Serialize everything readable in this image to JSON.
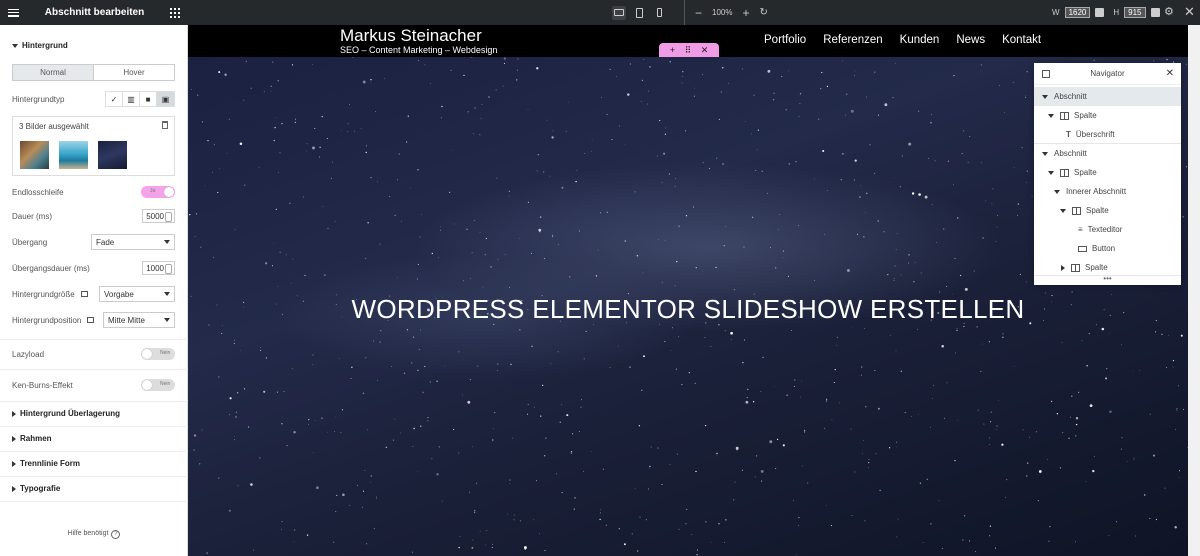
{
  "topbar": {
    "panel_title": "Abschnitt bearbeiten",
    "zoom_level": "100%",
    "width_label": "W",
    "width_value": "1620",
    "height_label": "H",
    "height_value": "915"
  },
  "sidebar": {
    "section_title": "Hintergrund",
    "tab_normal": "Normal",
    "tab_hover": "Hover",
    "bg_type_label": "Hintergrundtyp",
    "gallery_label": "3 Bilder ausgewählt",
    "loop_label": "Endlosschleife",
    "loop_toggle_text": "Ja",
    "duration_label": "Dauer (ms)",
    "duration_value": "5000",
    "transition_label": "Übergang",
    "transition_value": "Fade",
    "transition_duration_label": "Übergangsdauer (ms)",
    "transition_duration_value": "1000",
    "bg_size_label": "Hintergrundgröße",
    "bg_size_value": "Vorgabe",
    "bg_position_label": "Hintergrundposition",
    "bg_position_value": "Mitte Mitte",
    "lazyload_label": "Lazyload",
    "lazyload_toggle_text": "Nein",
    "kenburns_label": "Ken-Burns-Effekt",
    "kenburns_toggle_text": "Nein",
    "collapsed_sections": [
      "Hintergrund Überlagerung",
      "Rahmen",
      "Trennlinie Form",
      "Typografie"
    ],
    "help_text": "Hilfe benötigt"
  },
  "site": {
    "brand_name": "Markus Steinacher",
    "brand_tagline": "SEO – Content Marketing – Webdesign",
    "menu": [
      "Portfolio",
      "Referenzen",
      "Kunden",
      "News",
      "Kontakt"
    ],
    "hero_title": "WORDPRESS ELEMENTOR SLIDESHOW ERSTELLEN"
  },
  "navigator": {
    "title": "Navigator",
    "items": [
      {
        "label": "Abschnitt"
      },
      {
        "label": "Spalte"
      },
      {
        "label": "Überschrift"
      },
      {
        "label": "Abschnitt"
      },
      {
        "label": "Spalte"
      },
      {
        "label": "Innerer Abschnitt"
      },
      {
        "label": "Spalte"
      },
      {
        "label": "Texteditor"
      },
      {
        "label": "Button"
      },
      {
        "label": "Spalte"
      }
    ]
  },
  "colors": {
    "editor_dark": "#26292c",
    "accent_pink": "#f09be5",
    "sky": "#1b2140"
  }
}
